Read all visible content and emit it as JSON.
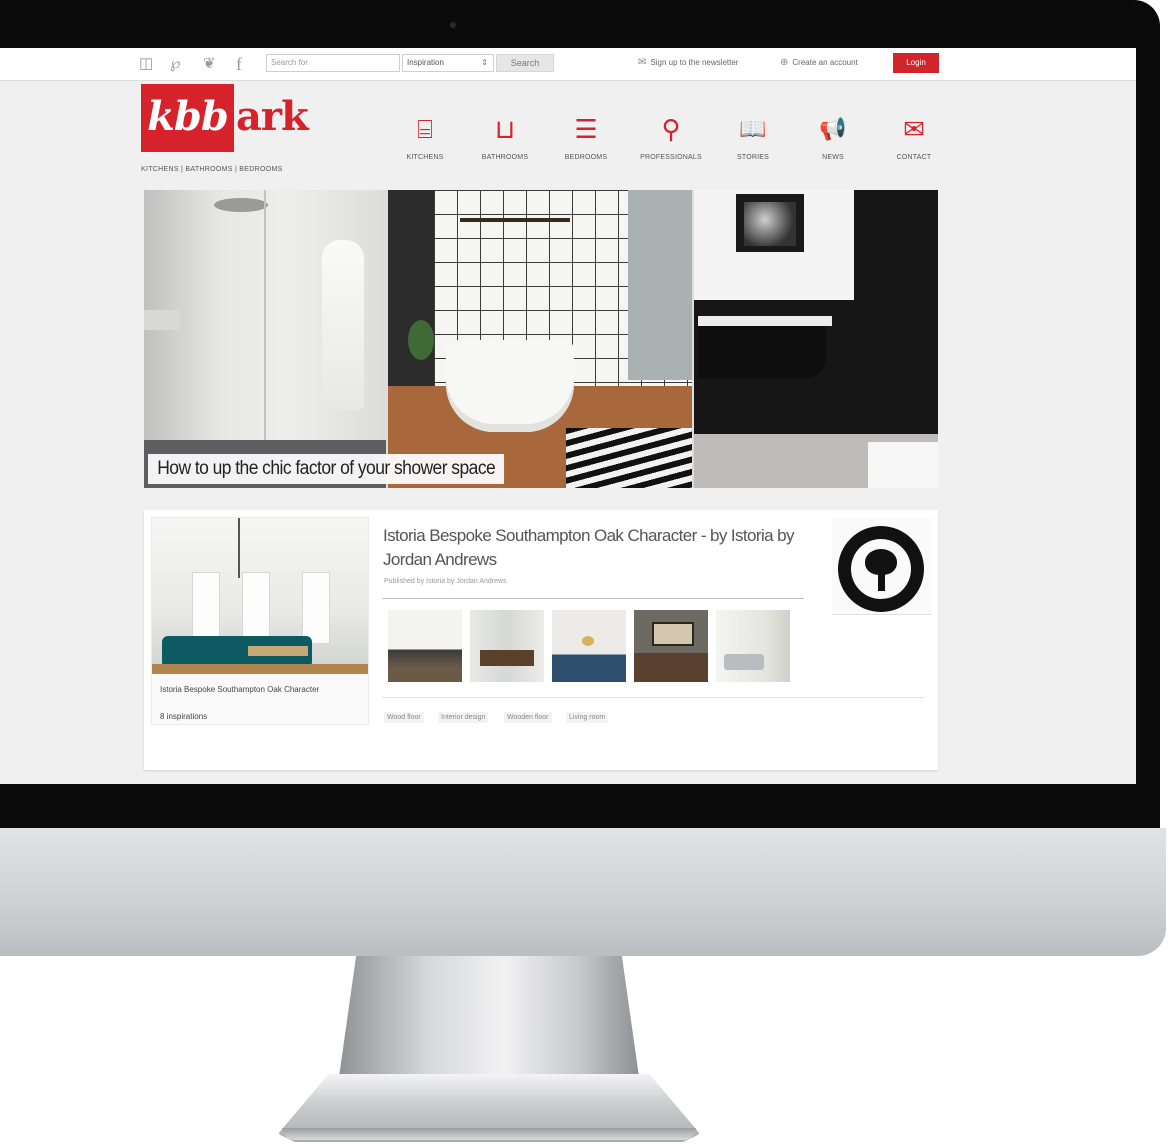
{
  "topbar": {
    "social": [
      {
        "icon": "instagram-icon",
        "glyph": "◫"
      },
      {
        "icon": "pinterest-icon",
        "glyph": "℘"
      },
      {
        "icon": "twitter-icon",
        "glyph": "❦"
      },
      {
        "icon": "facebook-icon",
        "glyph": "f"
      }
    ],
    "search_placeholder": "Search for",
    "search_scope": "Inspiration",
    "search_button": "Search",
    "newsletter": "Sign up to the newsletter",
    "create_account": "Create an account",
    "login": "Login"
  },
  "logo": {
    "kbb": "kbb",
    "ark": "ark",
    "tagline": "KITCHENS | BATHROOMS | BEDROOMS"
  },
  "nav": [
    {
      "label": "KITCHENS",
      "icon": "oven-icon",
      "glyph": "⌸"
    },
    {
      "label": "BATHROOMS",
      "icon": "bathtub-icon",
      "glyph": "⊔"
    },
    {
      "label": "BEDROOMS",
      "icon": "bed-icon",
      "glyph": "☰"
    },
    {
      "label": "PROFESSIONALS",
      "icon": "magnifier-icon",
      "glyph": "⚲"
    },
    {
      "label": "STORIES",
      "icon": "book-icon",
      "glyph": "📖"
    },
    {
      "label": "NEWS",
      "icon": "megaphone-icon",
      "glyph": "📢"
    },
    {
      "label": "CONTACT",
      "icon": "envelope-icon",
      "glyph": "✉"
    }
  ],
  "hero": {
    "caption": "How to up the chic factor of your shower space"
  },
  "feature": {
    "cover_title": "Istoria Bespoke Southampton Oak Character",
    "cover_count": "8 inspirations",
    "title": "Istoria Bespoke Southampton Oak Character - by Istoria by Jordan Andrews",
    "published": "Published by Istoria by Jordan Andrews",
    "tags": [
      "Wood floor",
      "Interior design",
      "Wooden floor",
      "Living room"
    ]
  },
  "colors": {
    "brand_red": "#d6222a",
    "screen_bg": "#f0f0f0"
  }
}
